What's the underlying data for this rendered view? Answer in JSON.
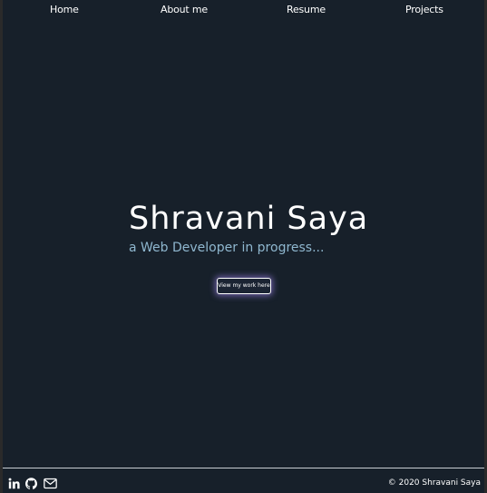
{
  "nav": {
    "items": [
      {
        "label": "Home"
      },
      {
        "label": "About me"
      },
      {
        "label": "Resume"
      },
      {
        "label": "Projects"
      }
    ]
  },
  "hero": {
    "name": "Shravani Saya",
    "tagline": "a Web Developer in progress...",
    "cta_label": "View my work here"
  },
  "footer": {
    "social_icons": [
      "linkedin-icon",
      "github-icon",
      "mail-icon"
    ],
    "copyright": "© 2020 Shravani Saya"
  },
  "colors": {
    "background": "#17202a",
    "tagline": "#8fb7cf",
    "text": "#ffffff",
    "button_glow": "#aa8cff"
  }
}
